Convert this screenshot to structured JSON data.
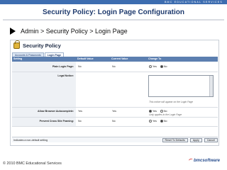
{
  "header": {
    "brand": "BMC EDUCATIONAL SERVICES"
  },
  "slide": {
    "title": "Security Policy: Login Page Configuration",
    "bullet": "Admin > Security Policy > Login Page"
  },
  "screenshot": {
    "title": "Security Policy",
    "tabs": [
      {
        "label": "Accounts & Passwords",
        "active": false
      },
      {
        "label": "Login Page",
        "active": true
      }
    ],
    "columns": [
      "Setting",
      "Default Value",
      "Current Value",
      "Change To"
    ],
    "rows": [
      {
        "label": "Plain Login Page:",
        "default": "No",
        "current": "No",
        "options": [
          "Yes",
          "No"
        ],
        "selected": "No"
      },
      {
        "label": "Legal Notice:",
        "default": "",
        "current": "",
        "hint": "This notice will appear on the Login Page"
      },
      {
        "label": "Allow Browser Autocomplete:",
        "default": "Yes",
        "current": "Yes",
        "options": [
          "Yes",
          "No"
        ],
        "selected": "Yes",
        "hint": "Only applies to the Login Page"
      },
      {
        "label": "Prevent Cross Site Framing:",
        "default": "No",
        "current": "No",
        "options": [
          "Yes",
          "No"
        ],
        "selected": "No"
      }
    ],
    "footer_note": "Indicates a non-default setting",
    "buttons": {
      "reset": "Reset To Defaults",
      "apply": "Apply",
      "cancel": "Cancel"
    }
  },
  "footer": {
    "copyright": "© 2010 BMC Educational Services",
    "logo": "bmcsoftware"
  }
}
